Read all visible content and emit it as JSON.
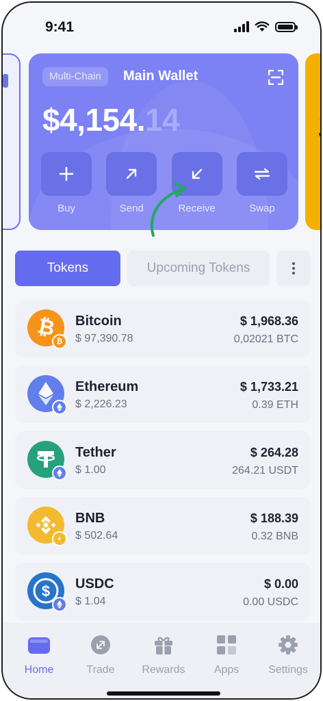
{
  "status": {
    "time": "9:41"
  },
  "wallet": {
    "chip": "Multi-Chain",
    "name": "Main Wallet",
    "balance_main": "$4,154.",
    "balance_cents": "14",
    "actions": [
      {
        "label": "Buy",
        "icon": "plus-icon"
      },
      {
        "label": "Send",
        "icon": "arrow-up-right-icon"
      },
      {
        "label": "Receive",
        "icon": "arrow-down-left-icon"
      },
      {
        "label": "Swap",
        "icon": "swap-icon"
      }
    ],
    "accent": "#7c81f3"
  },
  "peek_right": {
    "glyph": "S"
  },
  "tabs": {
    "active": "Tokens",
    "inactive": "Upcoming Tokens"
  },
  "tokens": [
    {
      "name": "Bitcoin",
      "price": "$ 97,390.78",
      "value": "$ 1,968.36",
      "amount": "0,02021 BTC",
      "color": "#f7931a",
      "icon": "bitcoin-icon"
    },
    {
      "name": "Ethereum",
      "price": "$ 2,226.23",
      "value": "$ 1,733.21",
      "amount": "0.39 ETH",
      "color": "#627eea",
      "icon": "ethereum-icon"
    },
    {
      "name": "Tether",
      "price": "$ 1.00",
      "value": "$ 264.28",
      "amount": "264.21 USDT",
      "color": "#26a17b",
      "icon": "tether-icon"
    },
    {
      "name": "BNB",
      "price": "$ 502.64",
      "value": "$ 188.39",
      "amount": "0.32 BNB",
      "color": "#f3ba2f",
      "icon": "bnb-icon"
    },
    {
      "name": "USDC",
      "price": "$ 1.04",
      "value": "$ 0.00",
      "amount": "0.00 USDC",
      "color": "#2775ca",
      "icon": "usdc-icon"
    }
  ],
  "nav": [
    {
      "label": "Home",
      "icon": "wallet-icon",
      "active": true
    },
    {
      "label": "Trade",
      "icon": "trade-icon",
      "active": false
    },
    {
      "label": "Rewards",
      "icon": "gift-icon",
      "active": false
    },
    {
      "label": "Apps",
      "icon": "apps-icon",
      "active": false
    },
    {
      "label": "Settings",
      "icon": "gear-icon",
      "active": false
    }
  ],
  "colors": {
    "primary": "#656bef",
    "background": "#f5f6fa",
    "muted": "#9aa0ad"
  }
}
